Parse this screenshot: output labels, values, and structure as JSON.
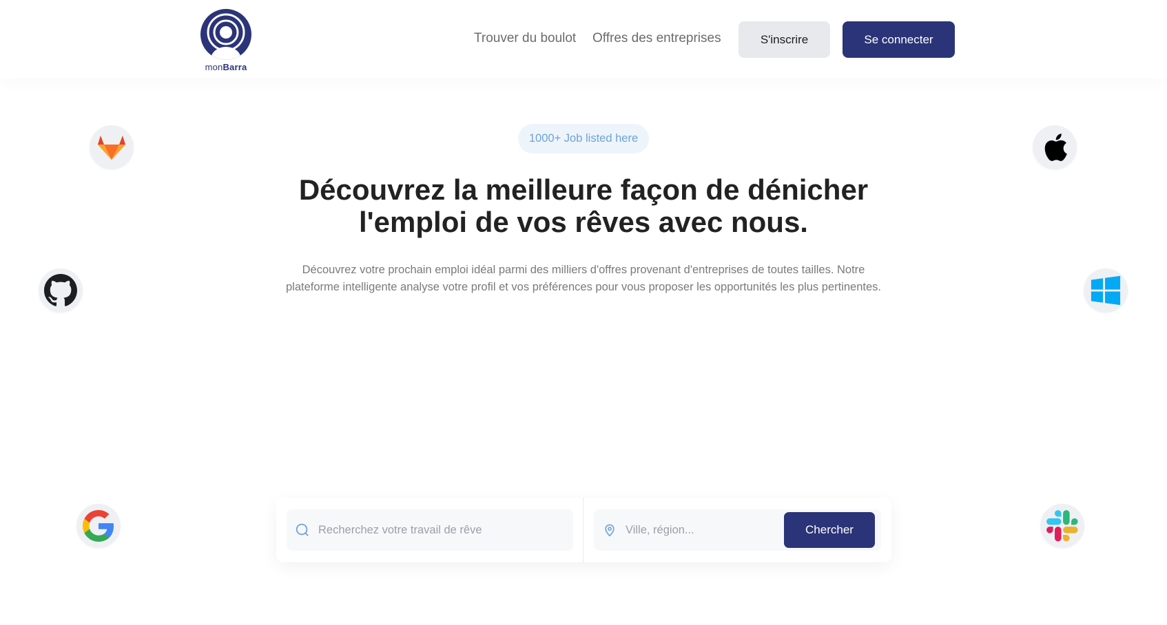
{
  "brand": {
    "name_light": "mon",
    "name_bold": "Barra",
    "color": "#2b3478"
  },
  "nav": {
    "links": [
      "Trouver du boulot",
      "Offres des entreprises"
    ],
    "signup_label": "S'inscrire",
    "login_label": "Se connecter"
  },
  "hero": {
    "badge": "1000+ Job listed here",
    "headline": {
      "part1": "Découvrez la ",
      "highlight1": "meilleure",
      "part2": " façon de dénicher",
      "highlight2": "l'emploi",
      "part3": " de vos rêves avec nous."
    },
    "subtitle": "Découvrez votre prochain emploi idéal parmi des milliers d'offres provenant d'entreprises de toutes tailles. Notre plateforme intelligente analyse votre profil et vos préférences pour vous proposer les opportunités les plus pertinentes."
  },
  "search": {
    "job_placeholder": "Recherchez votre travail de rêve",
    "location_placeholder": "Ville, région...",
    "button_label": "Chercher"
  },
  "company_icons": [
    "gitlab-icon",
    "github-icon",
    "google-icon",
    "apple-icon",
    "windows-icon",
    "slack-icon"
  ],
  "colors": {
    "primary": "#2b3478",
    "highlight": "#8cc6ef",
    "badge_text": "#6ea3d8",
    "badge_bg": "#eef4fb"
  }
}
